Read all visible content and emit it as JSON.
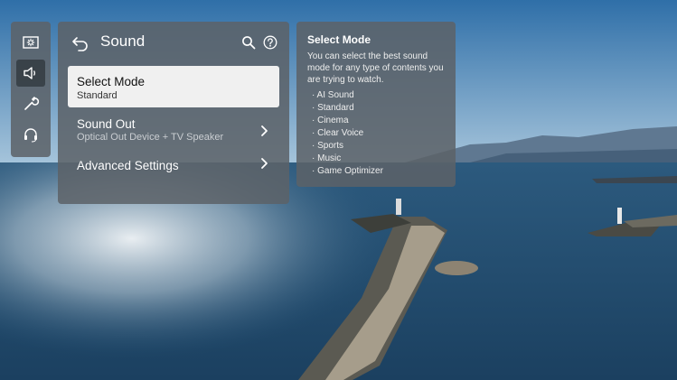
{
  "rail": {
    "items": [
      {
        "icon": "picture-icon"
      },
      {
        "icon": "speaker-icon",
        "active": true
      },
      {
        "icon": "wrench-icon"
      },
      {
        "icon": "headset-icon"
      }
    ]
  },
  "sound_panel": {
    "title": "Sound",
    "items": [
      {
        "label": "Select Mode",
        "value": "Standard",
        "selected": true
      },
      {
        "label": "Sound Out",
        "value": "Optical Out Device + TV Speaker"
      },
      {
        "label": "Advanced Settings"
      }
    ]
  },
  "info_panel": {
    "title": "Select Mode",
    "description": "You can select the best sound mode for any type of contents you are trying to watch.",
    "options": [
      "· AI Sound",
      "· Standard",
      "· Cinema",
      "· Clear Voice",
      "· Sports",
      "· Music",
      "· Game Optimizer"
    ]
  },
  "colors": {
    "panel": "#5c6268",
    "selected": "#f0f0f0",
    "text": "#ffffff"
  }
}
